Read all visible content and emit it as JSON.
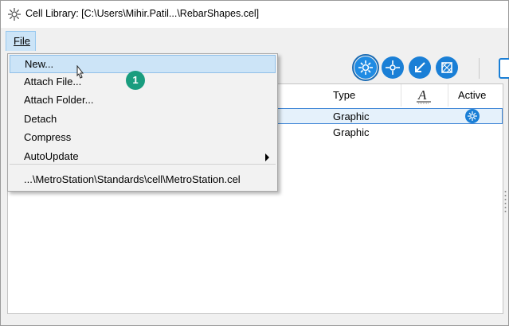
{
  "window": {
    "title": "Cell Library: [C:\\Users\\Mihir.Patil...\\RebarShapes.cel]"
  },
  "menubar": {
    "file_label": "File"
  },
  "file_menu": {
    "items": [
      {
        "label": "New...",
        "highlighted": true
      },
      {
        "label": "Attach File..."
      },
      {
        "label": "Attach Folder..."
      },
      {
        "label": "Detach"
      },
      {
        "label": "Compress"
      },
      {
        "label": "AutoUpdate",
        "has_submenu": true
      }
    ],
    "recent": [
      "...\\MetroStation\\Standards\\cell\\MetroStation.cel"
    ]
  },
  "table": {
    "columns": {
      "type": "Type",
      "active": "Active"
    },
    "rows": [
      {
        "type": "Graphic",
        "active": true,
        "selected": true
      },
      {
        "type": "Graphic",
        "active": false,
        "selected": false
      }
    ]
  },
  "toolbar": {
    "icons": [
      "cell-placement-icon",
      "cell-origin-icon",
      "cell-point-icon",
      "cell-pattern-icon"
    ]
  },
  "callout": {
    "number": "1"
  },
  "colors": {
    "accent": "#1a7fd6",
    "highlight": "#cce4f7",
    "callout": "#1a9d7f"
  }
}
